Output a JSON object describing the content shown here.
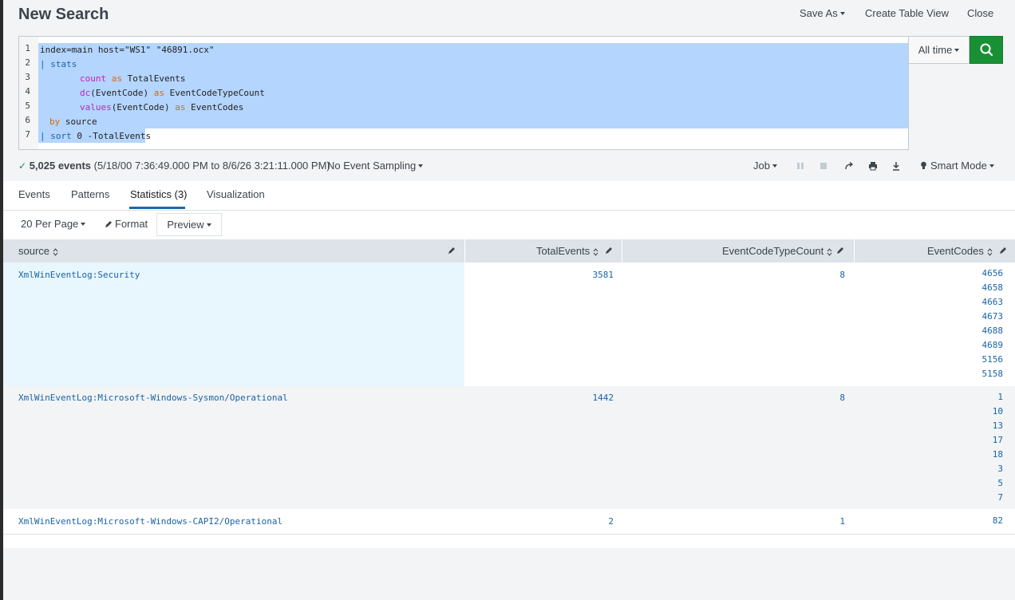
{
  "header": {
    "title": "New Search",
    "save_as": "Save As",
    "create_table_view": "Create Table View",
    "close": "Close"
  },
  "search": {
    "line_numbers": [
      "1",
      "2",
      "3",
      "4",
      "5",
      "6",
      "7"
    ],
    "lines": [
      "index=main host=\"WS1\" \"46891.ocx\"",
      "| stats",
      "count as TotalEvents",
      "dc(EventCode) as EventCodeTypeCount",
      "values(EventCode) as EventCodes",
      "by source",
      "| sort 0 -TotalEvents"
    ],
    "time_range": "All time",
    "search_icon": "magnifier-icon"
  },
  "status": {
    "check": "✓",
    "event_count": "5,025 events",
    "range": "(5/18/00 7:36:49.000 PM to 8/6/26 3:21:11.000 PM)",
    "sampling": "No Event Sampling",
    "job": "Job",
    "mode": "Smart Mode"
  },
  "tabs": [
    {
      "label": "Events"
    },
    {
      "label": "Patterns"
    },
    {
      "label": "Statistics (3)"
    },
    {
      "label": "Visualization"
    }
  ],
  "controls": {
    "per_page": "20 Per Page",
    "format": "Format",
    "preview": "Preview"
  },
  "table": {
    "columns": [
      "source",
      "TotalEvents",
      "EventCodeTypeCount",
      "EventCodes"
    ],
    "rows": [
      {
        "source": "XmlWinEventLog:Security",
        "total": "3581",
        "type_count": "8",
        "codes": [
          "4656",
          "4658",
          "4663",
          "4673",
          "4688",
          "4689",
          "5156",
          "5158"
        ]
      },
      {
        "source": "XmlWinEventLog:Microsoft-Windows-Sysmon/Operational",
        "total": "1442",
        "type_count": "8",
        "codes": [
          "1",
          "10",
          "13",
          "17",
          "18",
          "3",
          "5",
          "7"
        ]
      },
      {
        "source": "XmlWinEventLog:Microsoft-Windows-CAPI2/Operational",
        "total": "2",
        "type_count": "1",
        "codes": [
          "82"
        ]
      }
    ]
  },
  "colors": {
    "accent_green": "#1a9035",
    "link_blue": "#1a63a8",
    "selection": "#b4d5fe",
    "highlight_cell": "#e8f6fe"
  }
}
